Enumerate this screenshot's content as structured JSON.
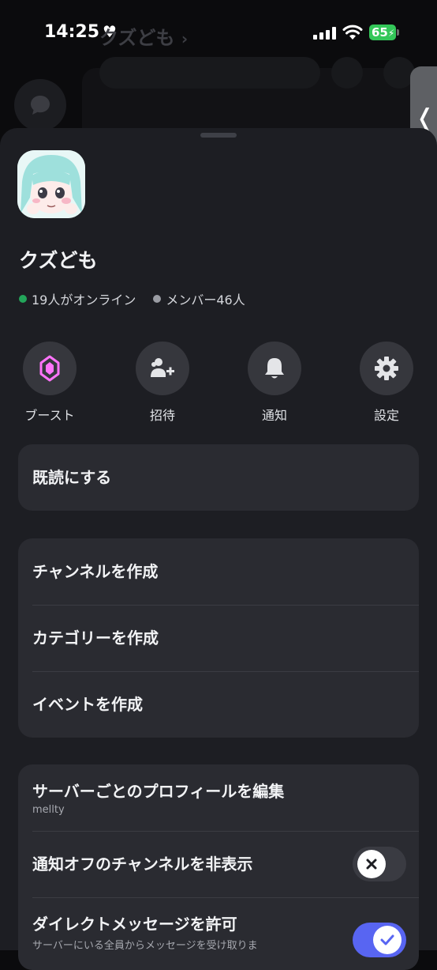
{
  "status_bar": {
    "time": "14:25",
    "battery": "65"
  },
  "background": {
    "title": "クズども"
  },
  "server": {
    "name": "クズども",
    "online": "19人がオンライン",
    "members": "メンバー46人",
    "online_color": "#23a55a",
    "member_color": "#9a9ca3"
  },
  "actions": [
    {
      "label": "ブースト",
      "icon": "boost-gem-icon"
    },
    {
      "label": "招待",
      "icon": "add-person-icon"
    },
    {
      "label": "通知",
      "icon": "bell-icon"
    },
    {
      "label": "設定",
      "icon": "gear-icon"
    }
  ],
  "mark_read": {
    "label": "既読にする"
  },
  "create": [
    {
      "label": "チャンネルを作成"
    },
    {
      "label": "カテゴリーを作成"
    },
    {
      "label": "イベントを作成"
    }
  ],
  "settings": {
    "edit_profile": {
      "label": "サーバーごとのプロフィールを編集",
      "sub": "mellty"
    },
    "hide_muted": {
      "label": "通知オフのチャンネルを非表示",
      "enabled": false
    },
    "allow_dm": {
      "label": "ダイレクトメッセージを許可",
      "sub": "サーバーにいる全員からメッセージを受け取りま",
      "enabled": true
    }
  },
  "colors": {
    "accent": "#5865f2",
    "boost": "#ff73fa"
  }
}
